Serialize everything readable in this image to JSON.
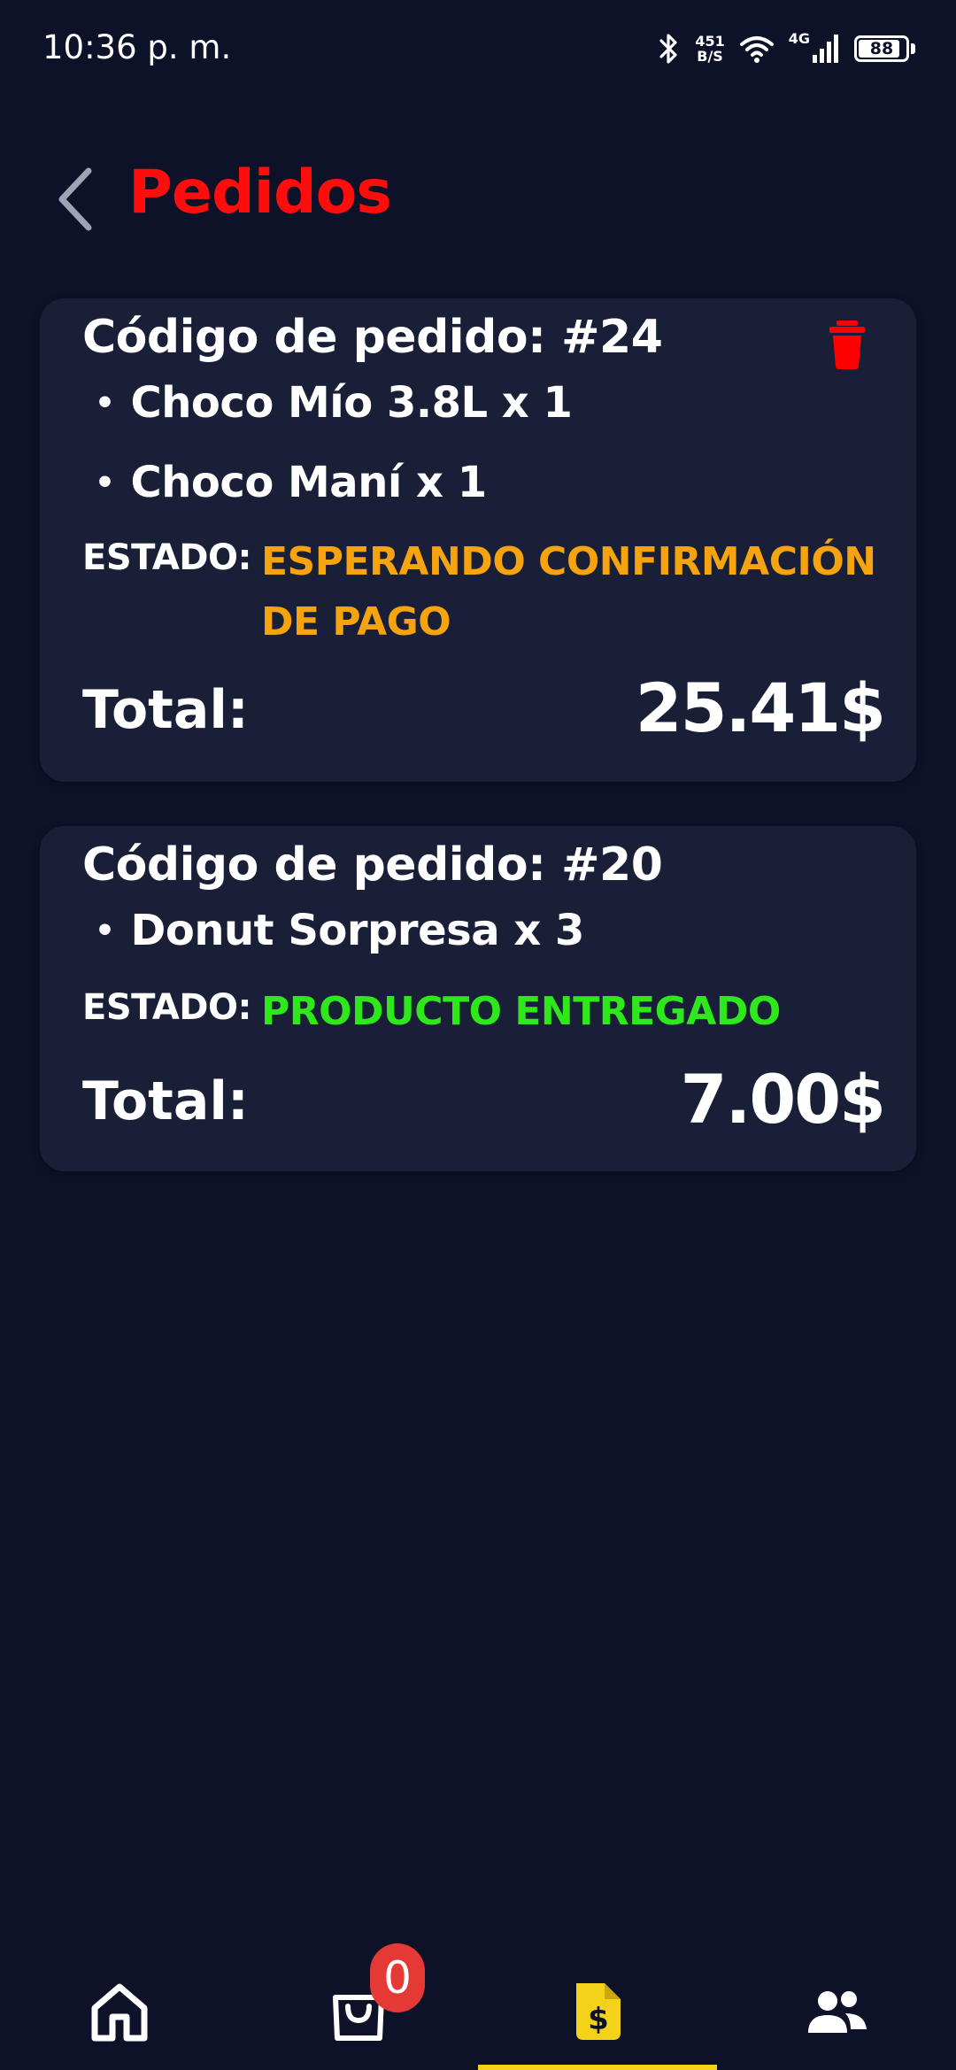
{
  "status_bar": {
    "time": "10:36 p. m.",
    "net_speed_value": "451",
    "net_speed_unit": "B/S",
    "network_type": "4G",
    "battery_level": "88",
    "battery_fraction": 0.88,
    "icons": [
      "bluetooth-icon",
      "wifi-icon",
      "signal-icon",
      "battery-icon"
    ]
  },
  "header": {
    "title": "Pedidos",
    "back_icon": "chevron-left-icon"
  },
  "colors": {
    "background": "#0e1229",
    "card": "#1a1f38",
    "title": "#ff0d0d",
    "pending": "#f5a30f",
    "delivered": "#2fe81b",
    "delete": "#ff0000",
    "active_nav": "#f5d21a"
  },
  "orders": [
    {
      "code_label": "Código de pedido: #24",
      "items": [
        "Choco Mío 3.8L x 1",
        "Choco Maní x 1"
      ],
      "status_label": "ESTADO:",
      "status_line1": "ESPERANDO CONFIRMACIÓN",
      "status_line2": "DE PAGO",
      "total_label": "Total:",
      "total_value": "25.41$",
      "deletable": true
    },
    {
      "code_label": "Código de pedido: #20",
      "items": [
        "Donut Sorpresa x 3"
      ],
      "status_label": "ESTADO:",
      "status_line1": "PRODUCTO ENTREGADO",
      "total_label": "Total:",
      "total_value": "7.00$",
      "deletable": false
    }
  ],
  "bottom_nav": {
    "items": [
      {
        "name": "home",
        "icon": "home-icon"
      },
      {
        "name": "cart",
        "icon": "shopping-bag-icon"
      },
      {
        "name": "orders",
        "icon": "invoice-dollar-icon",
        "active": true
      },
      {
        "name": "users",
        "icon": "people-icon"
      }
    ],
    "cart_badge": "0"
  }
}
